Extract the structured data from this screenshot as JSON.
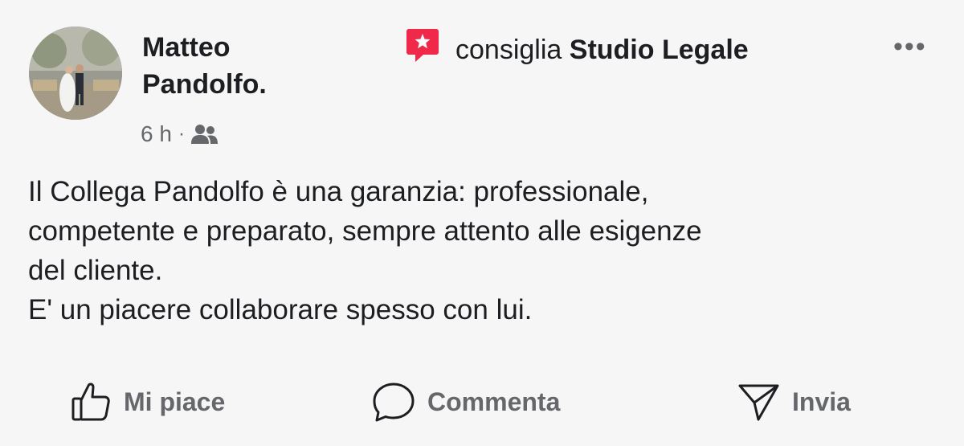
{
  "post": {
    "author_line1": "Matteo",
    "author_line2": "Pandolfo.",
    "recommend_verb": "consiglia",
    "recommended_page": "Studio Legale",
    "time": "6 h",
    "separator": "·",
    "audience_icon": "friends-icon",
    "more_label": "•••",
    "text_lines": [
      "Il Collega Pandolfo è una garanzia: professionale,",
      "competente e preparato, sempre attento alle esigenze",
      "del cliente.",
      "E' un piacere collaborare spesso con lui."
    ]
  },
  "actions": {
    "like": "Mi piace",
    "comment": "Commenta",
    "share": "Invia"
  },
  "colors": {
    "recommend_badge": "#f02849",
    "secondary_text": "#65676b",
    "primary_text": "#1c1e21",
    "background": "#f6f6f7"
  }
}
